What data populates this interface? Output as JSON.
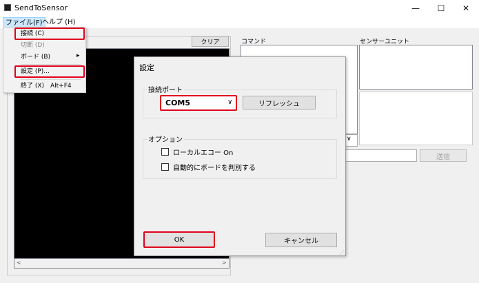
{
  "window": {
    "title": "SendToSensor",
    "minimize": "—",
    "maximize": "☐",
    "close": "✕"
  },
  "menubar": {
    "file": "ファイル(F)",
    "help": "ヘルプ (H)"
  },
  "file_menu": {
    "connect": "接続 (C)",
    "disconnect": "切断 (D)",
    "board": "ボード (B)",
    "board_arrow": "▸",
    "settings": "設定 (P)...",
    "exit": "終了 (X)",
    "exit_shortcut": "Alt+F4"
  },
  "main": {
    "clear_button": "クリア",
    "command_label": "コマンド",
    "sensor_unit_label": "センサーユニット",
    "send_button": "送信",
    "scroll_left": "<",
    "scroll_right": ">",
    "combo_arrow": "∨"
  },
  "dialog": {
    "title": "設定",
    "port_group": "接続ポート",
    "port_value": "COM5",
    "port_chevron": "∨",
    "refresh_button": "リフレッシュ",
    "options_group": "オプション",
    "local_echo": "ローカルエコー On",
    "auto_detect_board": "自動的にボードを判別する",
    "ok_button": "OK",
    "cancel_button": "キャンセル",
    "grip": "⋰"
  },
  "colors": {
    "highlight": "#e0001b",
    "terminal_bg": "#000000"
  }
}
